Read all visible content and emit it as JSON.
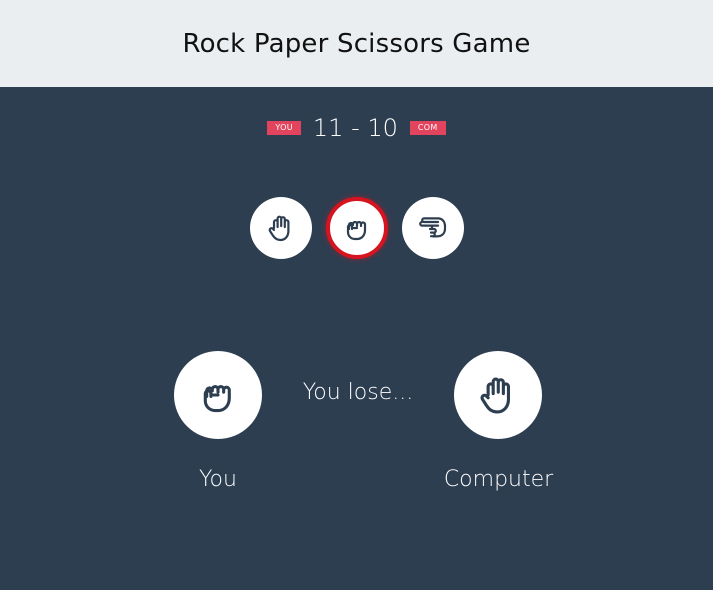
{
  "header": {
    "title": "Rock Paper Scissors Game"
  },
  "score": {
    "you_badge": "YOU",
    "text": "11 - 10",
    "com_badge": "COM"
  },
  "choices": [
    {
      "name": "paper",
      "icon": "open-hand-icon",
      "selected": false
    },
    {
      "name": "rock",
      "icon": "fist-icon",
      "selected": true
    },
    {
      "name": "scissors",
      "icon": "scissors-hand-icon",
      "selected": false
    }
  ],
  "result": {
    "text": "You lose..."
  },
  "players": {
    "you": {
      "label": "You",
      "hand": "fist-icon"
    },
    "computer": {
      "label": "Computer",
      "hand": "open-hand-icon"
    }
  },
  "colors": {
    "background": "#2e3e51",
    "header": "#ebeef0",
    "badge": "#e2435d",
    "selected_ring": "#d5141f"
  }
}
